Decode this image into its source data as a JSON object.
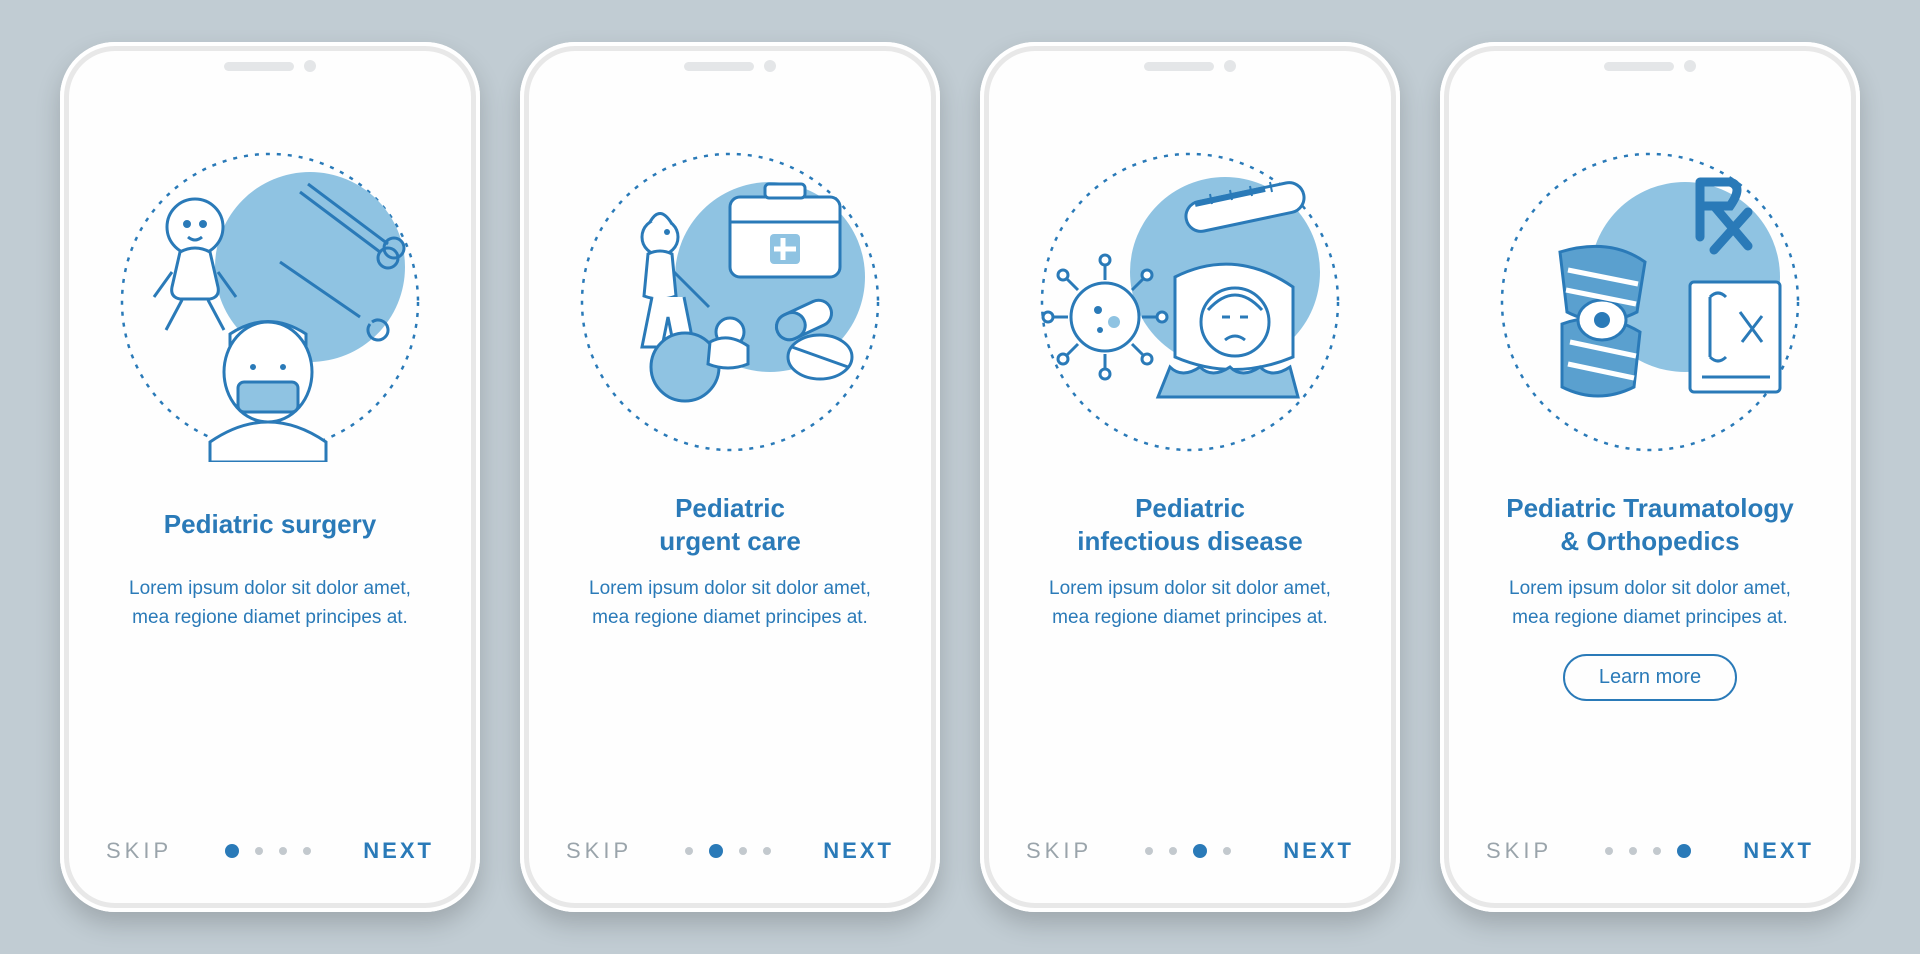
{
  "colors": {
    "accent": "#2a7ab8",
    "muted": "#9aa4ab",
    "bg": "#c1ccd3"
  },
  "nav": {
    "skip": "SKIP",
    "next": "NEXT",
    "pages": 4
  },
  "learn_more_label": "Learn more",
  "screens": [
    {
      "title": "Pediatric surgery",
      "desc": "Lorem ipsum dolor sit dolor amet, mea regione diamet principes at.",
      "active_dot": 0,
      "has_learn_more": false,
      "illustration": "surgery"
    },
    {
      "title": "Pediatric\nurgent care",
      "desc": "Lorem ipsum dolor sit dolor amet, mea regione diamet principes at.",
      "active_dot": 1,
      "has_learn_more": false,
      "illustration": "urgent-care"
    },
    {
      "title": "Pediatric\ninfectious disease",
      "desc": "Lorem ipsum dolor sit dolor amet, mea regione diamet principes at.",
      "active_dot": 2,
      "has_learn_more": false,
      "illustration": "infectious"
    },
    {
      "title": "Pediatric Traumatology\n& Orthopedics",
      "desc": "Lorem ipsum dolor sit dolor amet, mea regione diamet principes at.",
      "active_dot": 3,
      "has_learn_more": true,
      "illustration": "orthopedics"
    }
  ]
}
